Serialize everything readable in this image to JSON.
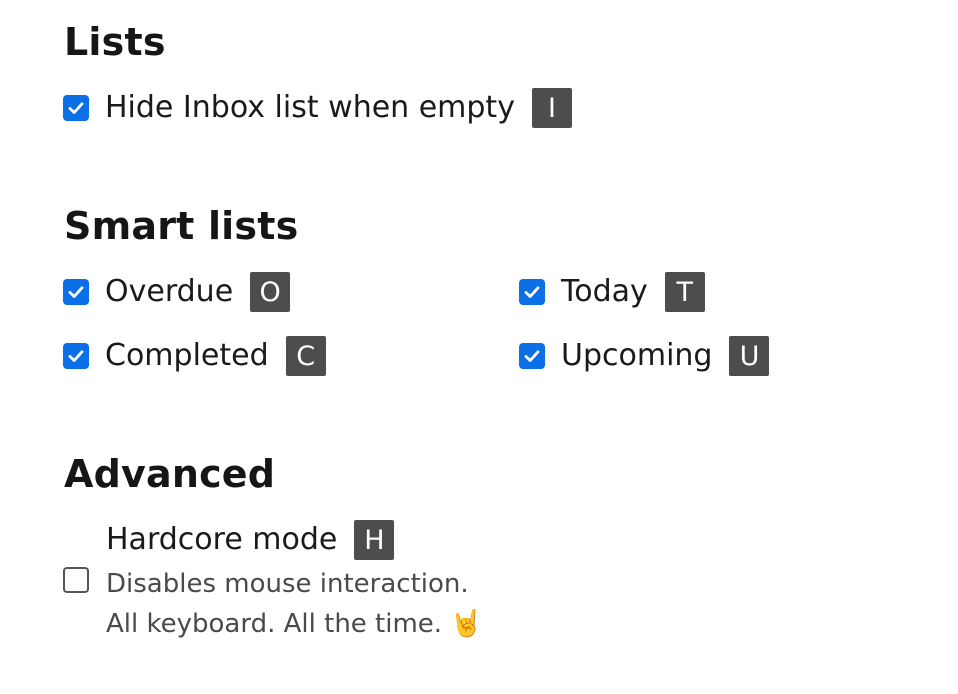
{
  "sections": {
    "lists": {
      "title": "Lists",
      "hide_inbox": {
        "label": "Hide Inbox list when empty",
        "key": "I",
        "checked": true
      }
    },
    "smart_lists": {
      "title": "Smart lists",
      "overdue": {
        "label": "Overdue",
        "key": "O",
        "checked": true
      },
      "today": {
        "label": "Today",
        "key": "T",
        "checked": true
      },
      "completed": {
        "label": "Completed",
        "key": "C",
        "checked": true
      },
      "upcoming": {
        "label": "Upcoming",
        "key": "U",
        "checked": true
      }
    },
    "advanced": {
      "title": "Advanced",
      "hardcore": {
        "label": "Hardcore mode",
        "key": "H",
        "checked": false,
        "description_line1": "Disables mouse interaction.",
        "description_line2": "All keyboard. All the time. 🤘"
      }
    }
  },
  "colors": {
    "checkbox_checked": "#0b6fe8",
    "key_badge": "#4d4d4d"
  }
}
